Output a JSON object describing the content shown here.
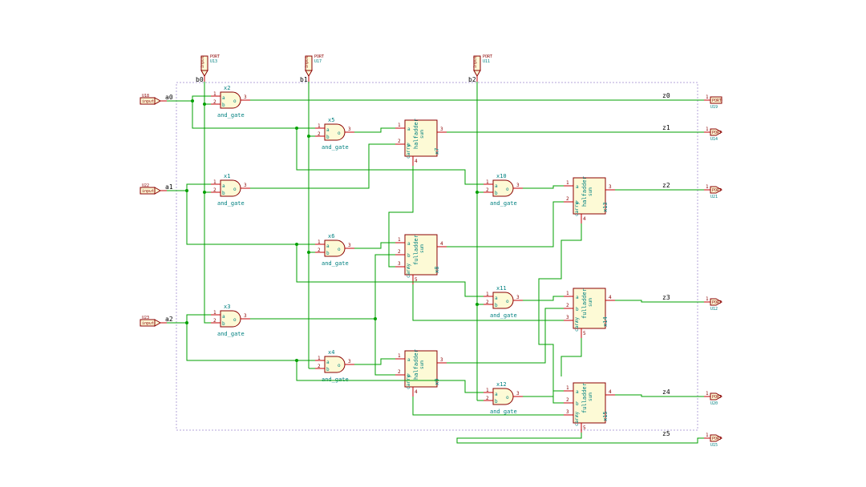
{
  "port_text": "PORT",
  "port_text2": "input",
  "inputs_a": [
    {
      "name": "a0",
      "u": "U18"
    },
    {
      "name": "a1",
      "u": "U22"
    },
    {
      "name": "a2",
      "u": "U23"
    }
  ],
  "inputs_b": [
    {
      "name": "b0",
      "u": "U13"
    },
    {
      "name": "b1",
      "u": "U17"
    },
    {
      "name": "b2",
      "u": "U11"
    }
  ],
  "outputs": [
    {
      "name": "z0",
      "u": "U19"
    },
    {
      "name": "z1",
      "u": "U14"
    },
    {
      "name": "z2",
      "u": "U21"
    },
    {
      "name": "z3",
      "u": "U12"
    },
    {
      "name": "z4",
      "u": "U20"
    },
    {
      "name": "z5",
      "u": "U15"
    }
  ],
  "and_type": "and_gate",
  "ha_type": "halfadder",
  "fa_type": "fulladder",
  "gates_and": [
    "x2",
    "x1",
    "x3",
    "x5",
    "x6",
    "x4",
    "x10",
    "x11",
    "x12"
  ],
  "adders": [
    "x7",
    "x8",
    "x9",
    "x13",
    "x14",
    "x15"
  ],
  "pin_a": "a",
  "pin_b": "b",
  "pin_o": "o",
  "pin_c": "c",
  "pin_sum": "sum",
  "pin_carry": "carry",
  "pin1": "1",
  "pin2": "2",
  "pin3": "3",
  "pin4": "4"
}
